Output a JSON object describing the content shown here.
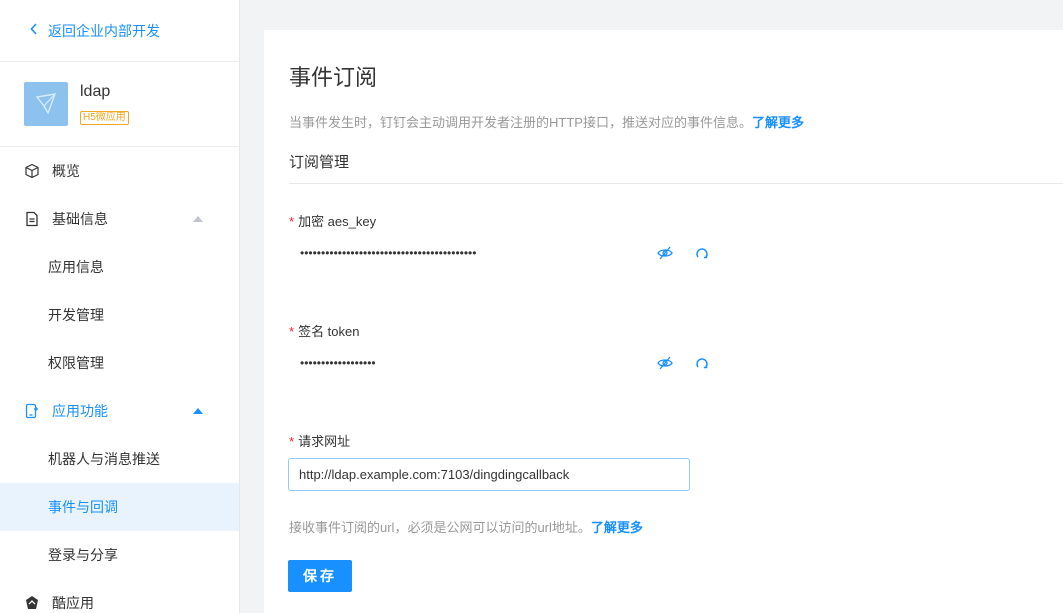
{
  "sidebar": {
    "back_label": "返回企业内部开发",
    "app": {
      "name": "ldap",
      "badge": "H5微应用"
    },
    "items": [
      {
        "label": "概览"
      },
      {
        "label": "基础信息"
      },
      {
        "label": "应用信息"
      },
      {
        "label": "开发管理"
      },
      {
        "label": "权限管理"
      },
      {
        "label": "应用功能"
      },
      {
        "label": "机器人与消息推送"
      },
      {
        "label": "事件与回调"
      },
      {
        "label": "登录与分享"
      },
      {
        "label": "酷应用"
      }
    ]
  },
  "main": {
    "title": "事件订阅",
    "description": "当事件发生时，钉钉会主动调用开发者注册的HTTP接口，推送对应的事件信息。",
    "learn_more": "了解更多",
    "section_title": "订阅管理",
    "aes_key": {
      "label": "加密 aes_key",
      "value": "••••••••••••••••••••••••••••••••••••••••••"
    },
    "token": {
      "label": "签名 token",
      "value": "••••••••••••••••••"
    },
    "url": {
      "label": "请求网址",
      "value": "http://ldap.example.com:7103/dingdingcallback"
    },
    "hint": "接收事件订阅的url，必须是公网可以访问的url地址。",
    "hint_link": "了解更多",
    "save_label": "保存"
  },
  "colors": {
    "accent": "#1890ff",
    "required": "#f5222d",
    "badge": "#f5a623",
    "selected_bg": "#e8f3fd"
  }
}
